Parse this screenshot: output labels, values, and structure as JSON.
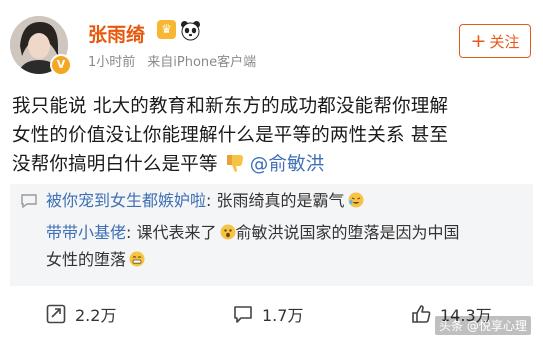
{
  "post": {
    "author": {
      "name": "张雨绮",
      "avatar_icon": "avatar-photo",
      "verified_icon": "verified-v-badge",
      "badge_icons": [
        "crown-badge-icon",
        "panda-emoji-icon"
      ]
    },
    "time": "1小时前",
    "source": "来自iPhone客户端",
    "follow_label": "关注",
    "follow_plus": "+",
    "content": {
      "line1": "我只能说 北大的教育和新东方的成功都没能帮你理解",
      "line2": "女性的价值没让你能理解什么是平等的两性关系 甚至",
      "line3": "没帮你搞明白什么是平等",
      "thumbs_down_icon": "thumbs-down-emoji",
      "mention": "@俞敏洪"
    }
  },
  "comments": [
    {
      "user": "被你宠到女生都嫉妒啦",
      "text": ": 张雨绮真的是霸气",
      "emoji": "crying-laughing-emoji"
    },
    {
      "user": "带带小基佬",
      "text": ": 课代表来了",
      "emoji": "shocked-emoji",
      "text2": "俞敏洪说国家的堕落是因为中国",
      "text3": "女性的堕落",
      "emoji2": "grinning-emoji"
    }
  ],
  "actions": {
    "repost": {
      "count": "2.2万",
      "icon": "repost-icon"
    },
    "comment": {
      "count": "1.7万",
      "icon": "comment-icon"
    },
    "like": {
      "count": "14.3万",
      "icon": "thumbs-up-icon"
    }
  },
  "watermark": "头条 @悦享心理",
  "colors": {
    "name": "#e8580c",
    "link": "#3f6fb5",
    "comment_bg": "#f4f5f7",
    "follow": "#e8581c"
  }
}
